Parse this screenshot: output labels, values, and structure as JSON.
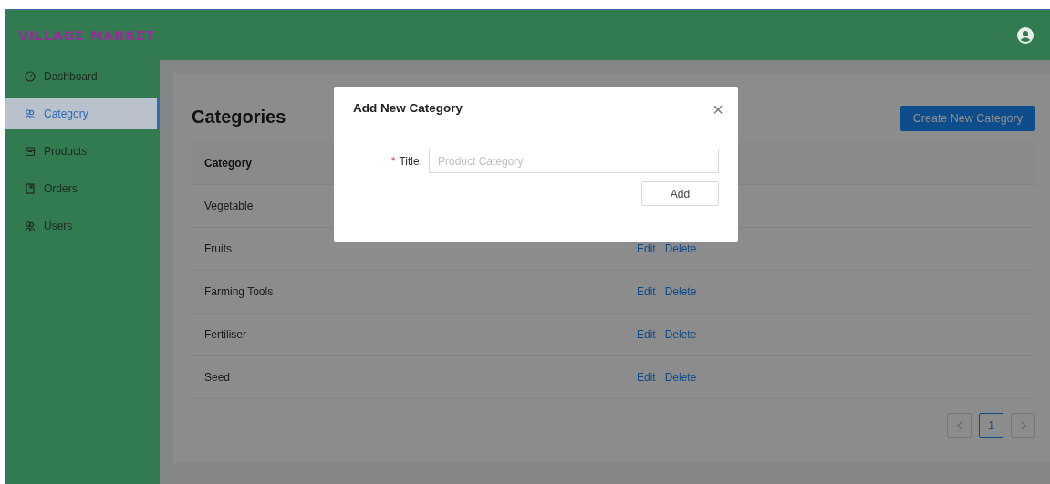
{
  "header": {
    "brand": "VILLAGE MARKET"
  },
  "sidebar": {
    "items": [
      {
        "label": "Dashboard",
        "kind": "gauge",
        "selected": false
      },
      {
        "label": "Category",
        "kind": "people",
        "selected": true
      },
      {
        "label": "Products",
        "kind": "bag",
        "selected": false
      },
      {
        "label": "Orders",
        "kind": "book",
        "selected": false
      },
      {
        "label": "Users",
        "kind": "people",
        "selected": false
      }
    ]
  },
  "page": {
    "title": "Categories",
    "create_button": "Create New Category"
  },
  "table": {
    "columns": [
      "Category"
    ],
    "rows": [
      {
        "category": "Vegetable",
        "actions": []
      },
      {
        "category": "Fruits",
        "actions": [
          "Edit",
          "Delete"
        ]
      },
      {
        "category": "Farming Tools",
        "actions": [
          "Edit",
          "Delete"
        ]
      },
      {
        "category": "Fertiliser",
        "actions": [
          "Edit",
          "Delete"
        ]
      },
      {
        "category": "Seed",
        "actions": [
          "Edit",
          "Delete"
        ]
      }
    ]
  },
  "pagination": {
    "pages": [
      {
        "label": "1",
        "selected": true
      }
    ]
  },
  "modal": {
    "title": "Add New Category",
    "close": "×",
    "field": {
      "label": "Title:",
      "required_mark": "*",
      "placeholder": "Product Category"
    },
    "submit": "Add"
  }
}
